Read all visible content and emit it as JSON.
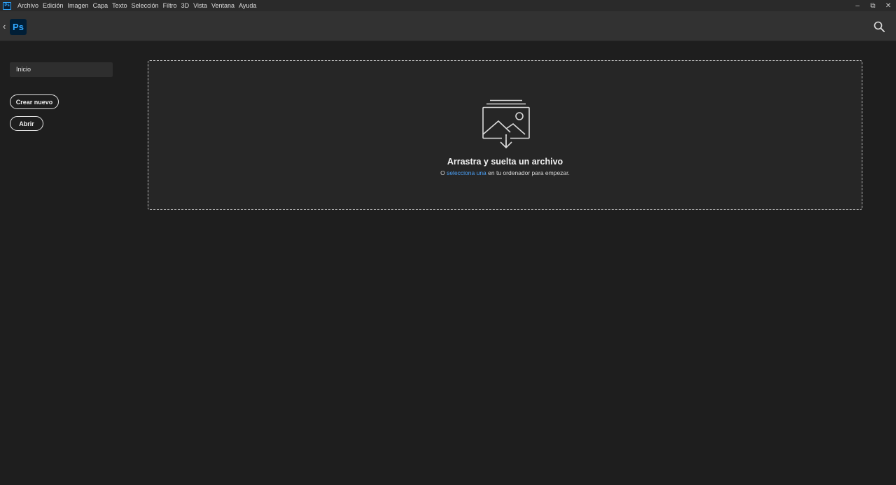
{
  "app": {
    "mini_icon_label": "Ps",
    "logo_label": "Ps",
    "accent": "#31a8ff"
  },
  "menubar": {
    "items": [
      "Archivo",
      "Edición",
      "Imagen",
      "Capa",
      "Texto",
      "Selección",
      "Filtro",
      "3D",
      "Vista",
      "Ventana",
      "Ayuda"
    ]
  },
  "window_controls": {
    "minimize": "–",
    "restore": "⧉",
    "close": "✕"
  },
  "header": {
    "back_icon": "‹",
    "search_icon": "search-icon"
  },
  "sidebar": {
    "home_label": "Inicio",
    "new_label": "Crear nuevo",
    "open_label": "Abrir"
  },
  "dropzone": {
    "icon": "image-upload-icon",
    "title": "Arrastra y suelta un archivo",
    "subtitle_prefix": "O ",
    "subtitle_link": "selecciona una",
    "subtitle_suffix": " en tu ordenador para empezar.",
    "link_color": "#4a9ff5"
  }
}
